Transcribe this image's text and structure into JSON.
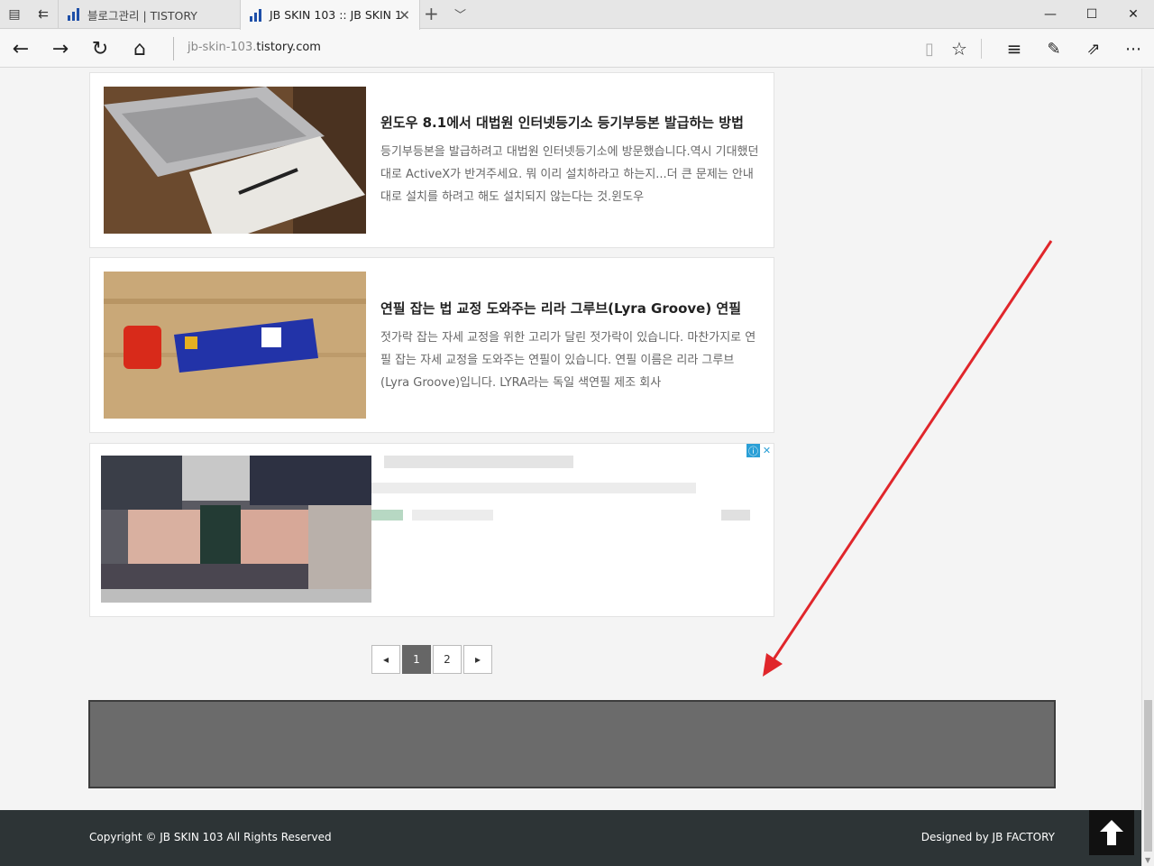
{
  "browser": {
    "tabs": [
      {
        "title": "블로그관리 | TISTORY",
        "active": false
      },
      {
        "title": "JB SKIN 103 :: JB SKIN 1",
        "active": true
      }
    ],
    "address": {
      "prefix": "jb-skin-103.",
      "host": "tistory.com"
    }
  },
  "posts": [
    {
      "title": "윈도우 8.1에서 대법원 인터넷등기소 등기부등본 발급하는 방법",
      "excerpt": "등기부등본을 발급하려고 대법원 인터넷등기소에 방문했습니다.역시 기대했던대로 ActiveX가 반겨주세요. 뭐 이리 설치하라고 하는지...더 큰 문제는 안내대로 설치를 하려고 해도 설치되지 않는다는 것.윈도우"
    },
    {
      "title": "연필 잡는 법 교정 도와주는 리라 그루브(Lyra Groove) 연필",
      "excerpt": "젓가락 잡는 자세 교정을 위한 고리가 달린 젓가락이 있습니다. 마찬가지로 연필 잡는 자세 교정을 도와주는 연필이 있습니다. 연필 이름은 리라 그루브(Lyra Groove)입니다. LYRA라는 독일 색연필 제조 회사"
    }
  ],
  "pagination": {
    "prev": "◂",
    "pages": [
      "1",
      "2"
    ],
    "current": "1",
    "next": "▸"
  },
  "footer": {
    "copyright": "Copyright © JB SKIN 103 All Rights Reserved",
    "designed": "Designed by JB FACTORY"
  },
  "colors": {
    "annotation_arrow": "#e0262b",
    "footer_bg": "#2d3436"
  }
}
